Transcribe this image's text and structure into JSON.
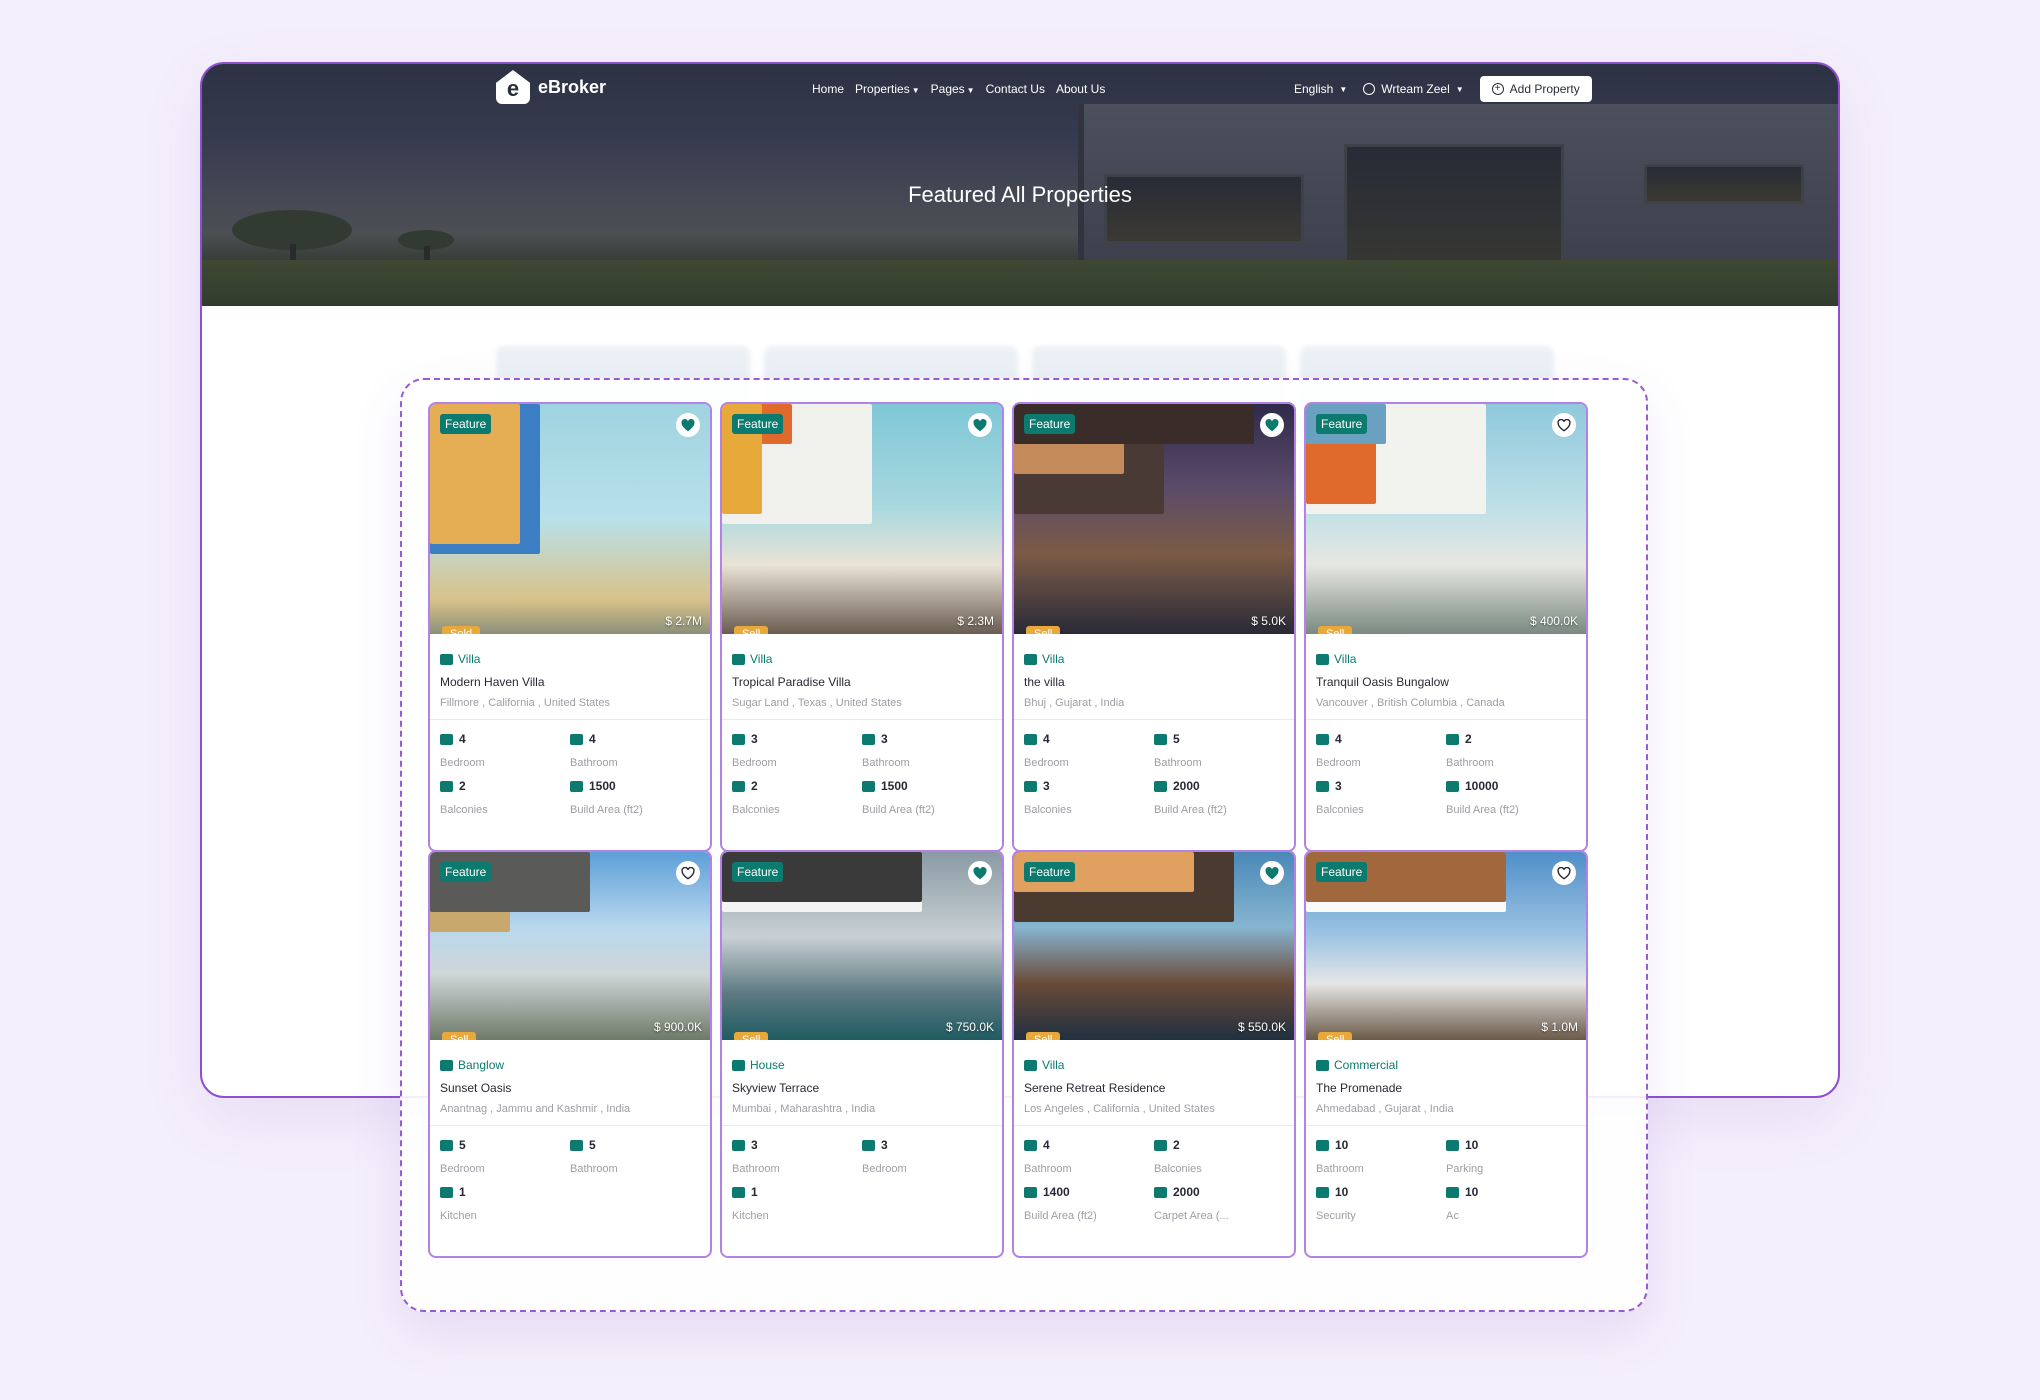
{
  "brand": {
    "name": "eBroker",
    "logo_letter": "e"
  },
  "nav": {
    "items": [
      {
        "label": "Home",
        "caret": false
      },
      {
        "label": "Properties",
        "caret": true
      },
      {
        "label": "Pages",
        "caret": true
      },
      {
        "label": "Contact Us",
        "caret": false
      },
      {
        "label": "About Us",
        "caret": false
      }
    ],
    "language": "English",
    "user": "Wrteam Zeel",
    "add_property": "Add Property"
  },
  "hero": {
    "title": "Featured All Properties"
  },
  "colors": {
    "accent": "#0c7a6f",
    "sell_tag": "#e8a93a",
    "highlight": "#9a5ad8"
  },
  "cards": [
    {
      "feature": "Feature",
      "favorite": true,
      "price": "$ 2.7M",
      "tag": "Sold",
      "type": "Villa",
      "type_icon": "villa-icon",
      "title": "Modern Haven Villa",
      "location": "Fillmore , California , United States",
      "specs": [
        {
          "icon": "bed-icon",
          "value": "4",
          "label": "Bedroom"
        },
        {
          "icon": "bath-icon",
          "value": "4",
          "label": "Bathroom"
        },
        {
          "icon": "balcony-icon",
          "value": "2",
          "label": "Balconies"
        },
        {
          "icon": "area-icon",
          "value": "1500",
          "label": "Build Area (ft2)"
        }
      ]
    },
    {
      "feature": "Feature",
      "favorite": true,
      "price": "$ 2.3M",
      "tag": "Sell",
      "type": "Villa",
      "type_icon": "villa-icon",
      "title": "Tropical Paradise Villa",
      "location": "Sugar Land , Texas , United States",
      "specs": [
        {
          "icon": "bed-icon",
          "value": "3",
          "label": "Bedroom"
        },
        {
          "icon": "bath-icon",
          "value": "3",
          "label": "Bathroom"
        },
        {
          "icon": "balcony-icon",
          "value": "2",
          "label": "Balconies"
        },
        {
          "icon": "area-icon",
          "value": "1500",
          "label": "Build Area (ft2)"
        }
      ]
    },
    {
      "feature": "Feature",
      "favorite": true,
      "price": "$ 5.0K",
      "tag": "Sell",
      "type": "Villa",
      "type_icon": "villa-icon",
      "title": "the villa",
      "location": "Bhuj , Gujarat , India",
      "specs": [
        {
          "icon": "bed-icon",
          "value": "4",
          "label": "Bedroom"
        },
        {
          "icon": "bath-icon",
          "value": "5",
          "label": "Bathroom"
        },
        {
          "icon": "balcony-icon",
          "value": "3",
          "label": "Balconies"
        },
        {
          "icon": "area-icon",
          "value": "2000",
          "label": "Build Area (ft2)"
        }
      ]
    },
    {
      "feature": "Feature",
      "favorite": false,
      "price": "$ 400.0K",
      "tag": "Sell",
      "type": "Villa",
      "type_icon": "villa-icon",
      "title": "Tranquil Oasis Bungalow",
      "location": "Vancouver , British Columbia , Canada",
      "specs": [
        {
          "icon": "bed-icon",
          "value": "4",
          "label": "Bedroom"
        },
        {
          "icon": "bath-icon",
          "value": "2",
          "label": "Bathroom"
        },
        {
          "icon": "balcony-icon",
          "value": "3",
          "label": "Balconies"
        },
        {
          "icon": "area-icon",
          "value": "10000",
          "label": "Build Area (ft2)"
        }
      ]
    },
    {
      "feature": "Feature",
      "favorite": false,
      "price": "$ 900.0K",
      "tag": "Sell",
      "type": "Banglow",
      "type_icon": "bungalow-icon",
      "title": "Sunset Oasis",
      "location": "Anantnag , Jammu and Kashmir , India",
      "specs": [
        {
          "icon": "bed-icon",
          "value": "5",
          "label": "Bedroom"
        },
        {
          "icon": "bath-icon",
          "value": "5",
          "label": "Bathroom"
        },
        {
          "icon": "kitchen-icon",
          "value": "1",
          "label": "Kitchen"
        }
      ]
    },
    {
      "feature": "Feature",
      "favorite": true,
      "price": "$ 750.0K",
      "tag": "Sell",
      "type": "House",
      "type_icon": "house-icon",
      "title": "Skyview Terrace",
      "location": "Mumbai , Maharashtra , India",
      "specs": [
        {
          "icon": "bath-icon",
          "value": "3",
          "label": "Bathroom"
        },
        {
          "icon": "bed-icon",
          "value": "3",
          "label": "Bedroom"
        },
        {
          "icon": "kitchen-icon",
          "value": "1",
          "label": "Kitchen"
        }
      ]
    },
    {
      "feature": "Feature",
      "favorite": true,
      "price": "$ 550.0K",
      "tag": "Sell",
      "type": "Villa",
      "type_icon": "villa-icon",
      "title": "Serene Retreat Residence",
      "location": "Los Angeles , California , United States",
      "specs": [
        {
          "icon": "bed-icon",
          "value": "4",
          "label": "Bathroom"
        },
        {
          "icon": "balcony-icon",
          "value": "2",
          "label": "Balconies"
        },
        {
          "icon": "area-icon",
          "value": "1400",
          "label": "Build Area (ft2)"
        },
        {
          "icon": "carpet-icon",
          "value": "2000",
          "label": "Carpet Area (..."
        }
      ]
    },
    {
      "feature": "Feature",
      "favorite": false,
      "price": "$ 1.0M",
      "tag": "Sell",
      "type": "Commercial",
      "type_icon": "commercial-icon",
      "title": "The Promenade",
      "location": "Ahmedabad , Gujarat , India",
      "specs": [
        {
          "icon": "bath-icon",
          "value": "10",
          "label": "Bathroom"
        },
        {
          "icon": "parking-icon",
          "value": "10",
          "label": "Parking"
        },
        {
          "icon": "security-icon",
          "value": "10",
          "label": "Security"
        },
        {
          "icon": "ac-icon",
          "value": "10",
          "label": "Ac"
        }
      ]
    }
  ]
}
